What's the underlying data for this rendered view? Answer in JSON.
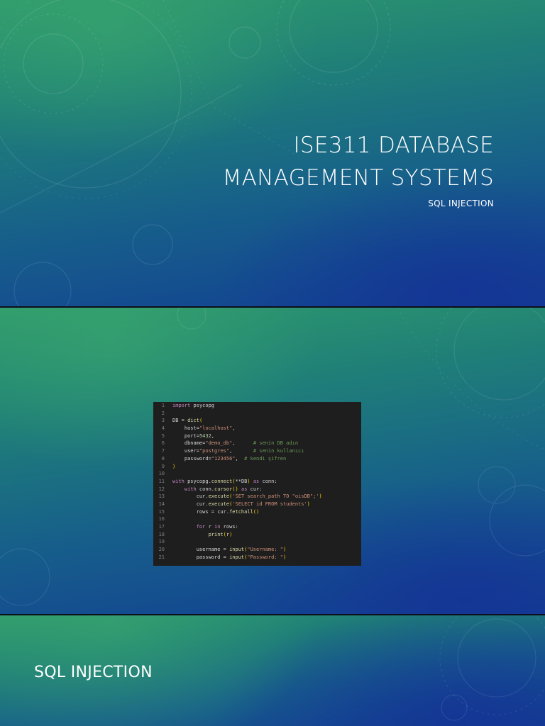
{
  "slides": [
    {
      "title_lines": [
        "ISE311 DATABASE",
        "MANAGEMENT SYSTEMS"
      ],
      "subtitle": "SQL INJECTION"
    },
    {
      "code_lines": [
        {
          "n": "1",
          "t": "import psycopg"
        },
        {
          "n": "2",
          "t": ""
        },
        {
          "n": "3",
          "t": "DB = dict("
        },
        {
          "n": "4",
          "t": "    host=\"localhost\","
        },
        {
          "n": "5",
          "t": "    port=5432,"
        },
        {
          "n": "6",
          "t": "    dbname=\"demo_db\",      # senin DB adın"
        },
        {
          "n": "7",
          "t": "    user=\"postgres\",       # senin kullanıcı"
        },
        {
          "n": "8",
          "t": "    password=\"123456\",  # kendi şifren"
        },
        {
          "n": "9",
          "t": ")"
        },
        {
          "n": "10",
          "t": ""
        },
        {
          "n": "11",
          "t": "with psycopg.connect(**DB) as conn:"
        },
        {
          "n": "12",
          "t": "    with conn.cursor() as cur:"
        },
        {
          "n": "13",
          "t": "        cur.execute('SET search_path TO \"oisDB\";')"
        },
        {
          "n": "14",
          "t": "        cur.execute('SELECT id FROM students')"
        },
        {
          "n": "15",
          "t": "        rows = cur.fetchall()"
        },
        {
          "n": "16",
          "t": ""
        },
        {
          "n": "17",
          "t": "        for r in rows:"
        },
        {
          "n": "18",
          "t": "            print(r)"
        },
        {
          "n": "19",
          "t": ""
        },
        {
          "n": "20",
          "t": "        username = input(\"Username: \")"
        },
        {
          "n": "21",
          "t": "        password = input(\"Password: \")"
        }
      ]
    },
    {
      "title": "SQL INJECTION"
    }
  ]
}
